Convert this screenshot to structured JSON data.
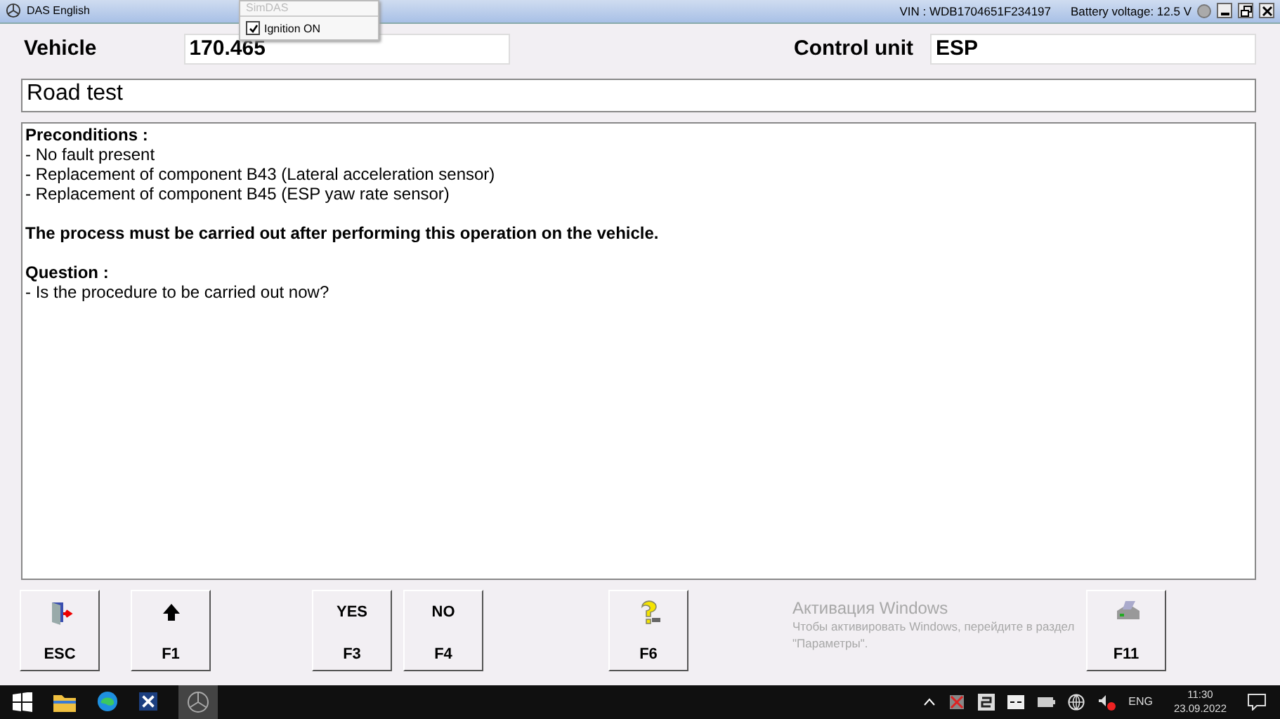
{
  "window": {
    "title": "DAS English",
    "vin": "VIN : WDB1704651F234197",
    "battery": "Battery voltage: 12.5 V"
  },
  "popup": {
    "title": "SimDAS",
    "options": [
      {
        "label": "Ignition ON",
        "checked": true
      }
    ]
  },
  "header": {
    "vehicle_label": "Vehicle",
    "vehicle_value": "170.465",
    "control_unit_label": "Control unit",
    "control_unit_value": "ESP"
  },
  "test_title": "Road test",
  "content": [
    {
      "kind": "heading",
      "text": "Preconditions :"
    },
    {
      "kind": "line",
      "text": "- No fault present"
    },
    {
      "kind": "line",
      "text": "- Replacement of component B43 (Lateral acceleration sensor)"
    },
    {
      "kind": "line",
      "text": "- Replacement of component B45 (ESP yaw rate sensor)"
    },
    {
      "kind": "gap"
    },
    {
      "kind": "heading",
      "text": "The process must be carried out after performing this operation on the vehicle."
    },
    {
      "kind": "gap"
    },
    {
      "kind": "heading",
      "text": "Question :"
    },
    {
      "kind": "line",
      "text": "- Is the procedure to be carried out now?"
    }
  ],
  "buttons": [
    {
      "key": "ESC",
      "kind": "exit"
    },
    {
      "key": "F1",
      "kind": "up"
    },
    {
      "key": "F3",
      "kind": "text",
      "top": "YES"
    },
    {
      "key": "F4",
      "kind": "text",
      "top": "NO"
    },
    {
      "key": "F6",
      "kind": "help"
    },
    {
      "key": "F11",
      "kind": "print"
    }
  ],
  "activation": {
    "title": "Активация Windows",
    "text": "Чтобы активировать Windows, перейдите в раздел \"Параметры\"."
  },
  "taskbar": {
    "language": "ENG",
    "time": "11:30",
    "date": "23.09.2022"
  }
}
